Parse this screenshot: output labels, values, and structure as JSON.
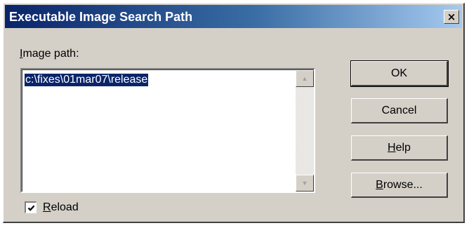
{
  "window": {
    "title": "Executable Image Search Path",
    "close_label": "×"
  },
  "image_path": {
    "label_first": "I",
    "label_rest": "mage path:",
    "value": "c:\\fixes\\01mar07\\release"
  },
  "buttons": {
    "ok": "OK",
    "cancel": "Cancel",
    "help_first": "H",
    "help_rest": "elp",
    "browse_first": "B",
    "browse_rest": "rowse..."
  },
  "reload": {
    "checked": true,
    "label_first": "R",
    "label_rest": "eload"
  },
  "icons": {
    "close": "close-icon",
    "scroll_up": "scroll-up-arrow-icon",
    "scroll_down": "scroll-down-arrow-icon",
    "checkmark": "checkmark-icon"
  }
}
